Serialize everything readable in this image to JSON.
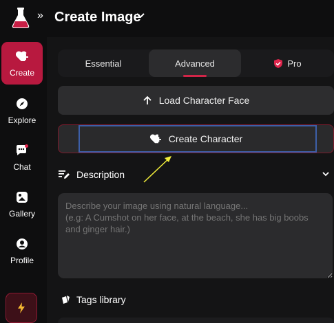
{
  "header": {
    "expand_glyph": "»",
    "title": "Create Image"
  },
  "sidebar": {
    "items": [
      {
        "label": "Create",
        "icon": "heart-plus-icon"
      },
      {
        "label": "Explore",
        "icon": "compass-icon"
      },
      {
        "label": "Chat",
        "icon": "chat-bubble-icon"
      },
      {
        "label": "Gallery",
        "icon": "gallery-icon"
      },
      {
        "label": "Profile",
        "icon": "profile-icon"
      }
    ],
    "boost_icon": "lightning-bolt-icon"
  },
  "tabs": [
    {
      "label": "Essential"
    },
    {
      "label": "Advanced"
    },
    {
      "label": "Pro"
    }
  ],
  "buttons": {
    "load_character_face": "Load Character Face",
    "create_character": "Create Character"
  },
  "description": {
    "label": "Description",
    "placeholder": "Describe your image using natural language...\n(e.g: A Cumshot on her face, at the beach, she has big boobs and ginger hair.)"
  },
  "tags": {
    "label": "Tags library"
  },
  "colors": {
    "accent": "#b8193f",
    "background": "#0e0e0f",
    "panel": "#141415",
    "button": "#2d2d2f",
    "annotation_box": "#3d5fa8",
    "annotation_arrow": "#f2ee3a"
  }
}
